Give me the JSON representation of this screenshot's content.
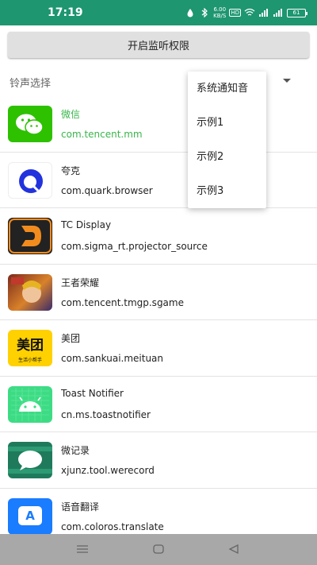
{
  "status_bar": {
    "time": "17:19",
    "net_speed_value": "6.00",
    "net_speed_unit": "KB/S",
    "hd_badge": "HD",
    "battery": "61",
    "bg_color": "#1e9670"
  },
  "permission_button": {
    "label": "开启监听权限"
  },
  "ringtone": {
    "label": "铃声选择"
  },
  "dropdown": {
    "options": [
      "系统通知音",
      "示例1",
      "示例2",
      "示例3"
    ]
  },
  "apps": [
    {
      "name": "微信",
      "package": "com.tencent.mm",
      "icon": "wechat-icon",
      "highlight": true,
      "highlight_color": "#39b54a"
    },
    {
      "name": "夸克",
      "package": "com.quark.browser",
      "icon": "quark-icon"
    },
    {
      "name": "TC Display",
      "package": "com.sigma_rt.projector_source",
      "icon": "tc-display-icon"
    },
    {
      "name": "王者荣耀",
      "package": "com.tencent.tmgp.sgame",
      "icon": "honor-of-kings-icon"
    },
    {
      "name": "美团",
      "package": "com.sankuai.meituan",
      "icon": "meituan-icon",
      "icon_text": "美团",
      "icon_subtext": "生活小帮手"
    },
    {
      "name": "Toast Notifier",
      "package": "cn.ms.toastnotifier",
      "icon": "android-icon"
    },
    {
      "name": "微记录",
      "package": "xjunz.tool.werecord",
      "icon": "werecord-icon"
    },
    {
      "name": "语音翻译",
      "package": "com.coloros.translate",
      "icon": "translate-icon",
      "icon_text": "A"
    }
  ],
  "nav_bar": {
    "buttons": [
      "menu-icon",
      "home-icon",
      "back-icon"
    ]
  }
}
